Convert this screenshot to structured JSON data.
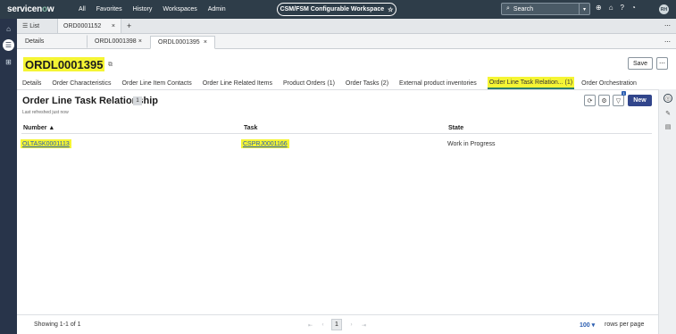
{
  "app": {
    "logo_text": "servicenow",
    "nav": [
      "All",
      "Favorites",
      "History",
      "Workspaces",
      "Admin"
    ],
    "workspace": "CSM/FSM Configurable Workspace",
    "search_placeholder": "Search",
    "avatar_initials": "RH",
    "icons": [
      "globe-icon",
      "chat-icon",
      "help-icon",
      "bell-icon"
    ]
  },
  "tabs_top": {
    "list_label": "List",
    "open_tab": "ORD0001152",
    "more": "⋯"
  },
  "tabs_sub": {
    "details": "Details",
    "tab_a": "ORDL0001398",
    "tab_b": "ORDL0001395",
    "more": "⋯"
  },
  "record": {
    "title": "ORDL0001395",
    "save_label": "Save",
    "more_label": "⋯"
  },
  "record_tabs": [
    "Details",
    "Order Characteristics",
    "Order Line Item Contacts",
    "Order Line Related Items",
    "Product Orders (1)",
    "Order Tasks (2)",
    "External product inventories",
    "Order Line Task Relation... (1)",
    "Order Orchestration"
  ],
  "related_list": {
    "title": "Order Line Task Relationship",
    "count": "1",
    "refreshed": "Last refreshed just now",
    "new_label": "New",
    "filter_badge": "1",
    "columns": {
      "number": "Number ▲",
      "task": "Task",
      "state": "State"
    },
    "rows": [
      {
        "number": "OLTASK0001113",
        "task": "CSPRJ0001166",
        "state": "Work in Progress"
      }
    ]
  },
  "footer": {
    "showing": "Showing 1-1 of 1",
    "current_page": "1",
    "rows_per_page_value": "100 ▾",
    "rows_per_page_label": "rows per page"
  },
  "colors": {
    "topnav": "#2e3d49",
    "highlight": "#f5f534",
    "primary_button": "#31458b",
    "link": "#2a5db0"
  }
}
